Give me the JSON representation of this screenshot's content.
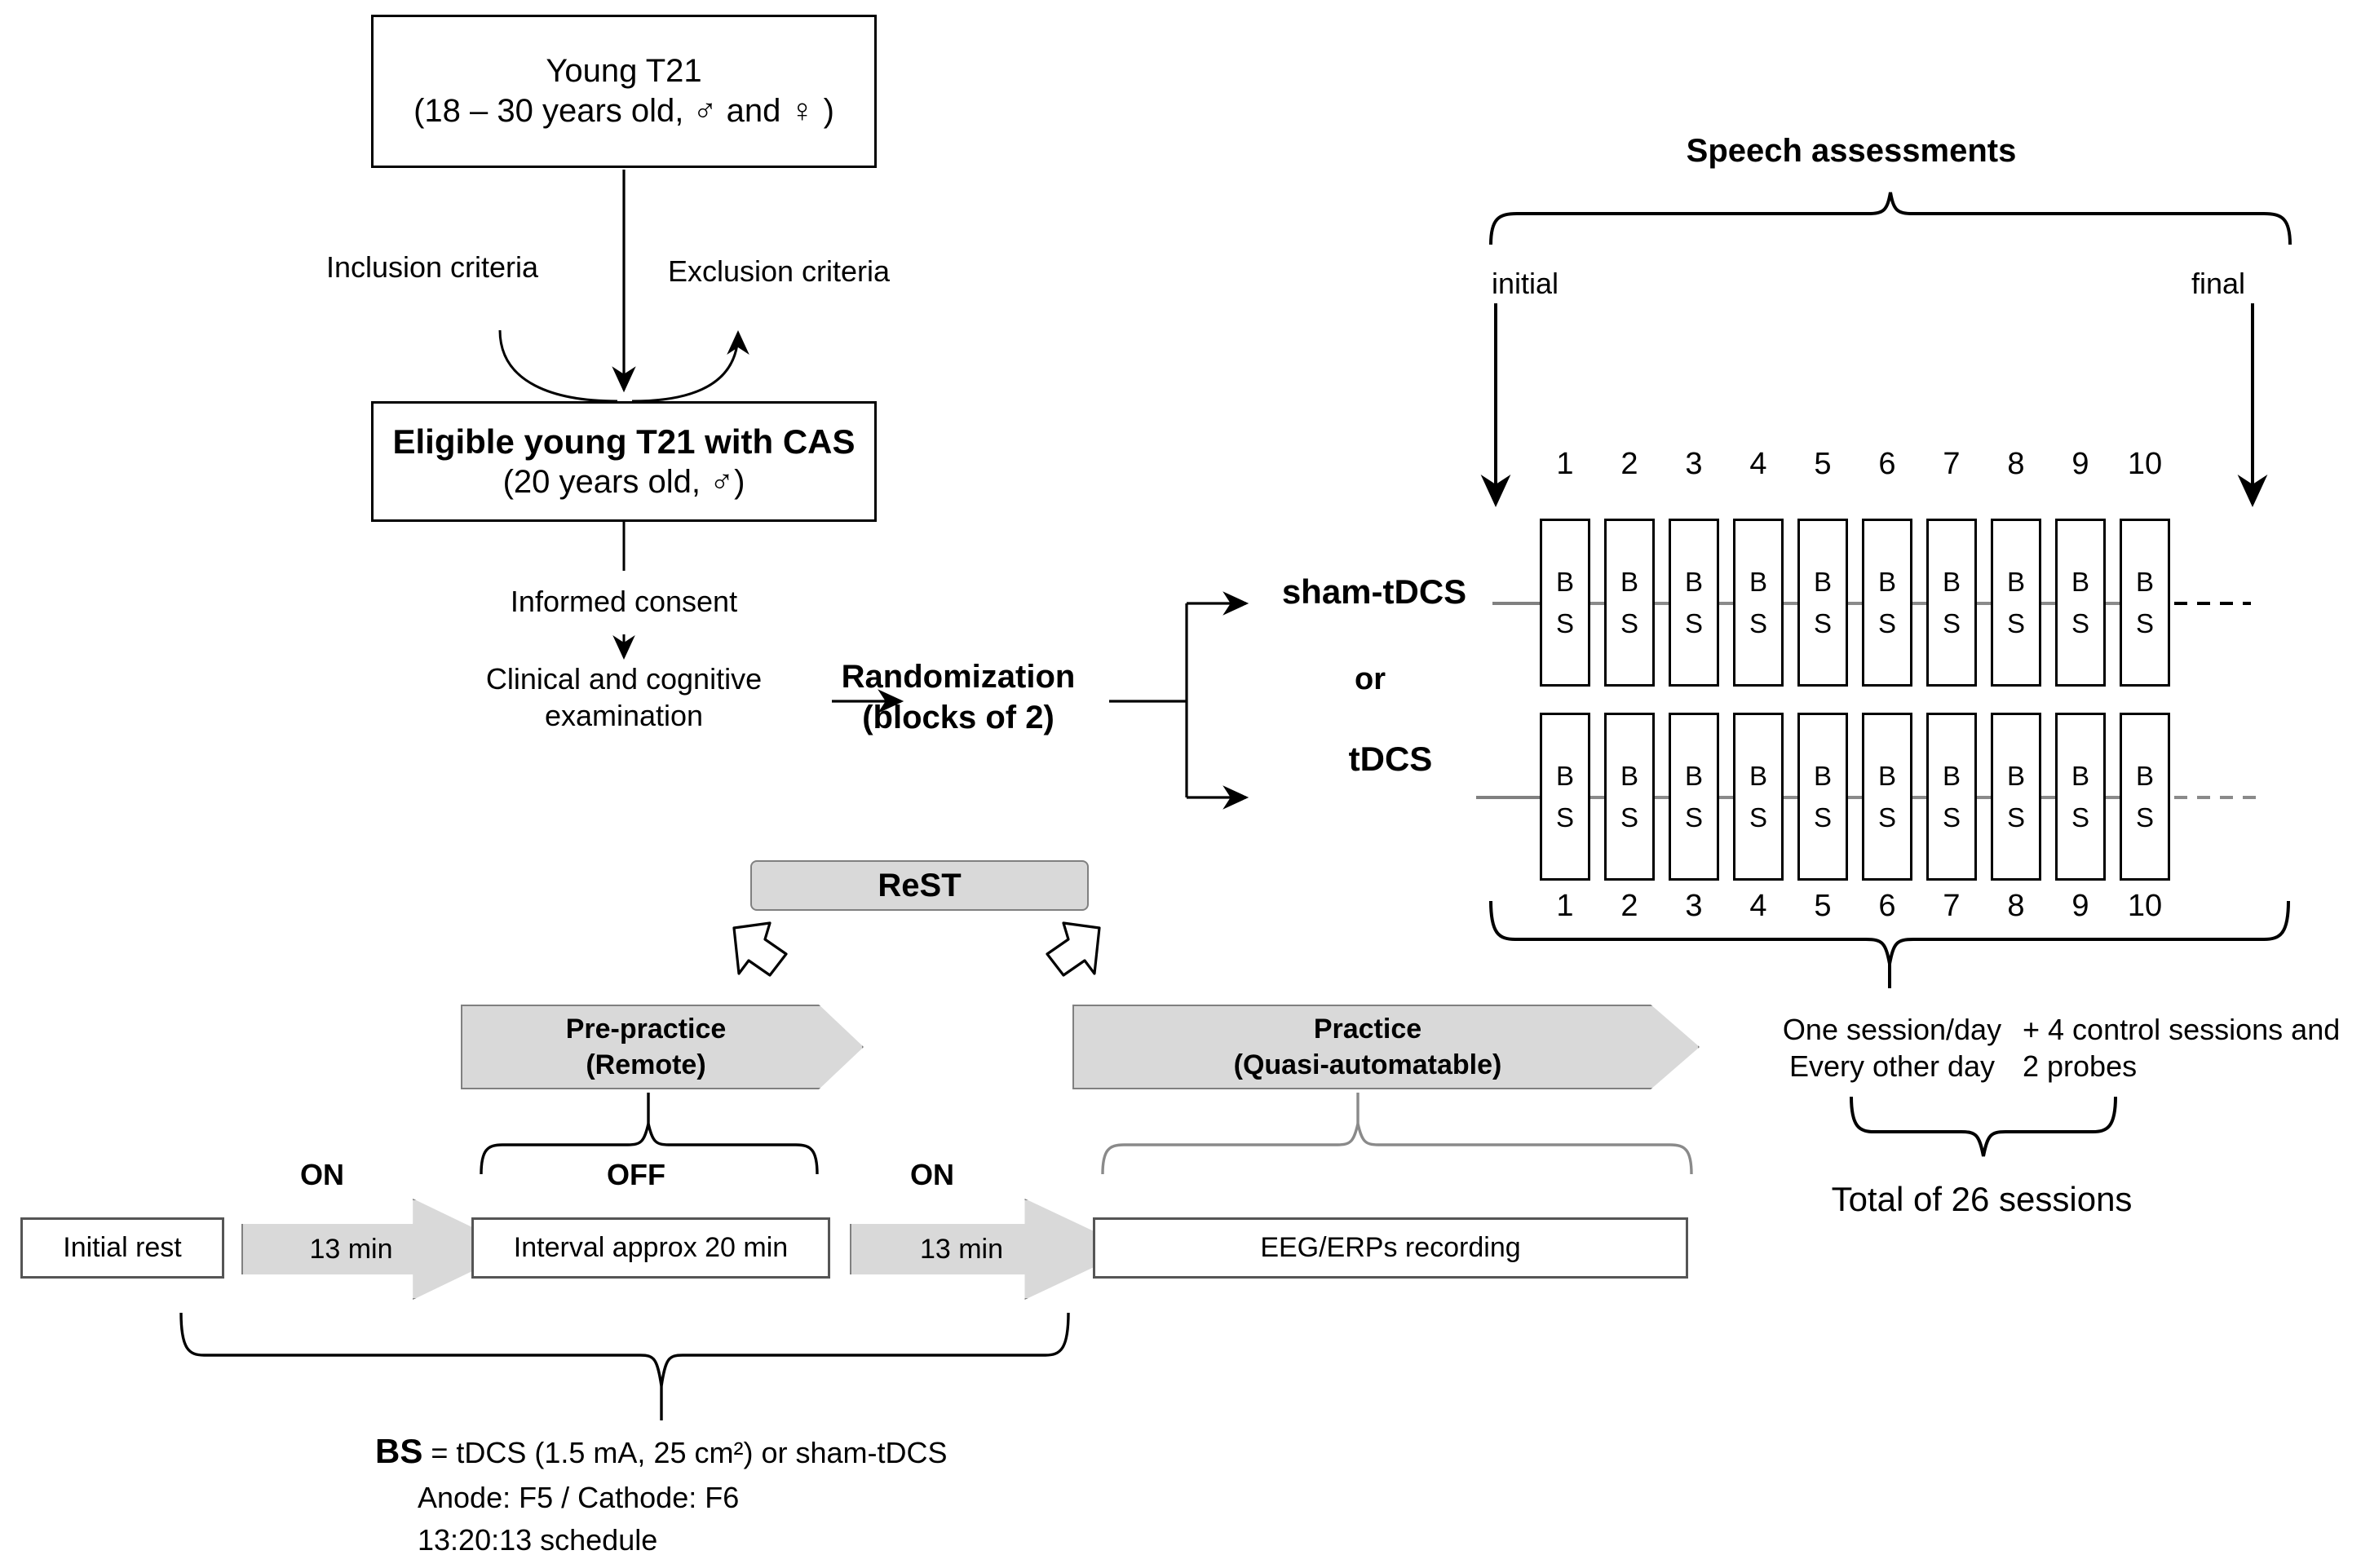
{
  "title": "Study protocol flowchart: tDCS and ReST speech therapy in young T21 with CAS",
  "recruitment": {
    "young_t21_line1": "Young T21",
    "young_t21_line2": "(18 – 30 years old, ♂ and ♀ )",
    "inclusion_criteria": "Inclusion criteria",
    "exclusion_criteria": "Exclusion criteria",
    "eligible_line1": "Eligible young T21 with CAS",
    "eligible_line2": "(20 years old, ♂)",
    "informed_consent": "Informed consent",
    "clinical_exam": "Clinical and cognitive examination",
    "randomization_line1": "Randomization",
    "randomization_line2": "(blocks of 2)"
  },
  "allocation": {
    "sham_label": "sham-tDCS",
    "or_label": "or",
    "tdcs_label": "tDCS"
  },
  "assessments": {
    "title": "Speech assessments",
    "initial": "initial",
    "final": "final"
  },
  "sessions": {
    "numbers_top": [
      "1",
      "2",
      "3",
      "4",
      "5",
      "6",
      "7",
      "8",
      "9",
      "10"
    ],
    "numbers_bottom": [
      "1",
      "2",
      "3",
      "4",
      "5",
      "6",
      "7",
      "8",
      "9",
      "10"
    ],
    "cell_line1": "B",
    "cell_line2": "S",
    "row_count": 2,
    "column_count": 10,
    "frequency_line1": "One session/day",
    "frequency_line2": "Every other day",
    "extra_line1": "+ 4 control sessions and",
    "extra_line2": "2 probes",
    "total": "Total of 26 sessions"
  },
  "session_structure": {
    "rest_label": "ReST",
    "pre_practice_line1": "Pre-practice",
    "pre_practice_line2": "(Remote)",
    "practice_line1": "Practice",
    "practice_line2": "(Quasi-automatable)",
    "initial_rest": "Initial rest",
    "on_label_1": "ON",
    "stim_duration_1": "13 min",
    "off_label": "OFF",
    "interval": "Interval approx 20 min",
    "on_label_2": "ON",
    "stim_duration_2": "13 min",
    "eeg": "EEG/ERPs recording"
  },
  "legend": {
    "bs_key": "BS",
    "bs_definition": " = tDCS (1.5 mA, 25 cm²) or sham-tDCS",
    "electrodes": "Anode: F5 / Cathode: F6",
    "schedule": "13:20:13 schedule"
  },
  "colors": {
    "stroke": "#000000",
    "gray_fill": "#d9d9d9",
    "gray_stroke": "#808080",
    "connector_gray": "#808080"
  }
}
